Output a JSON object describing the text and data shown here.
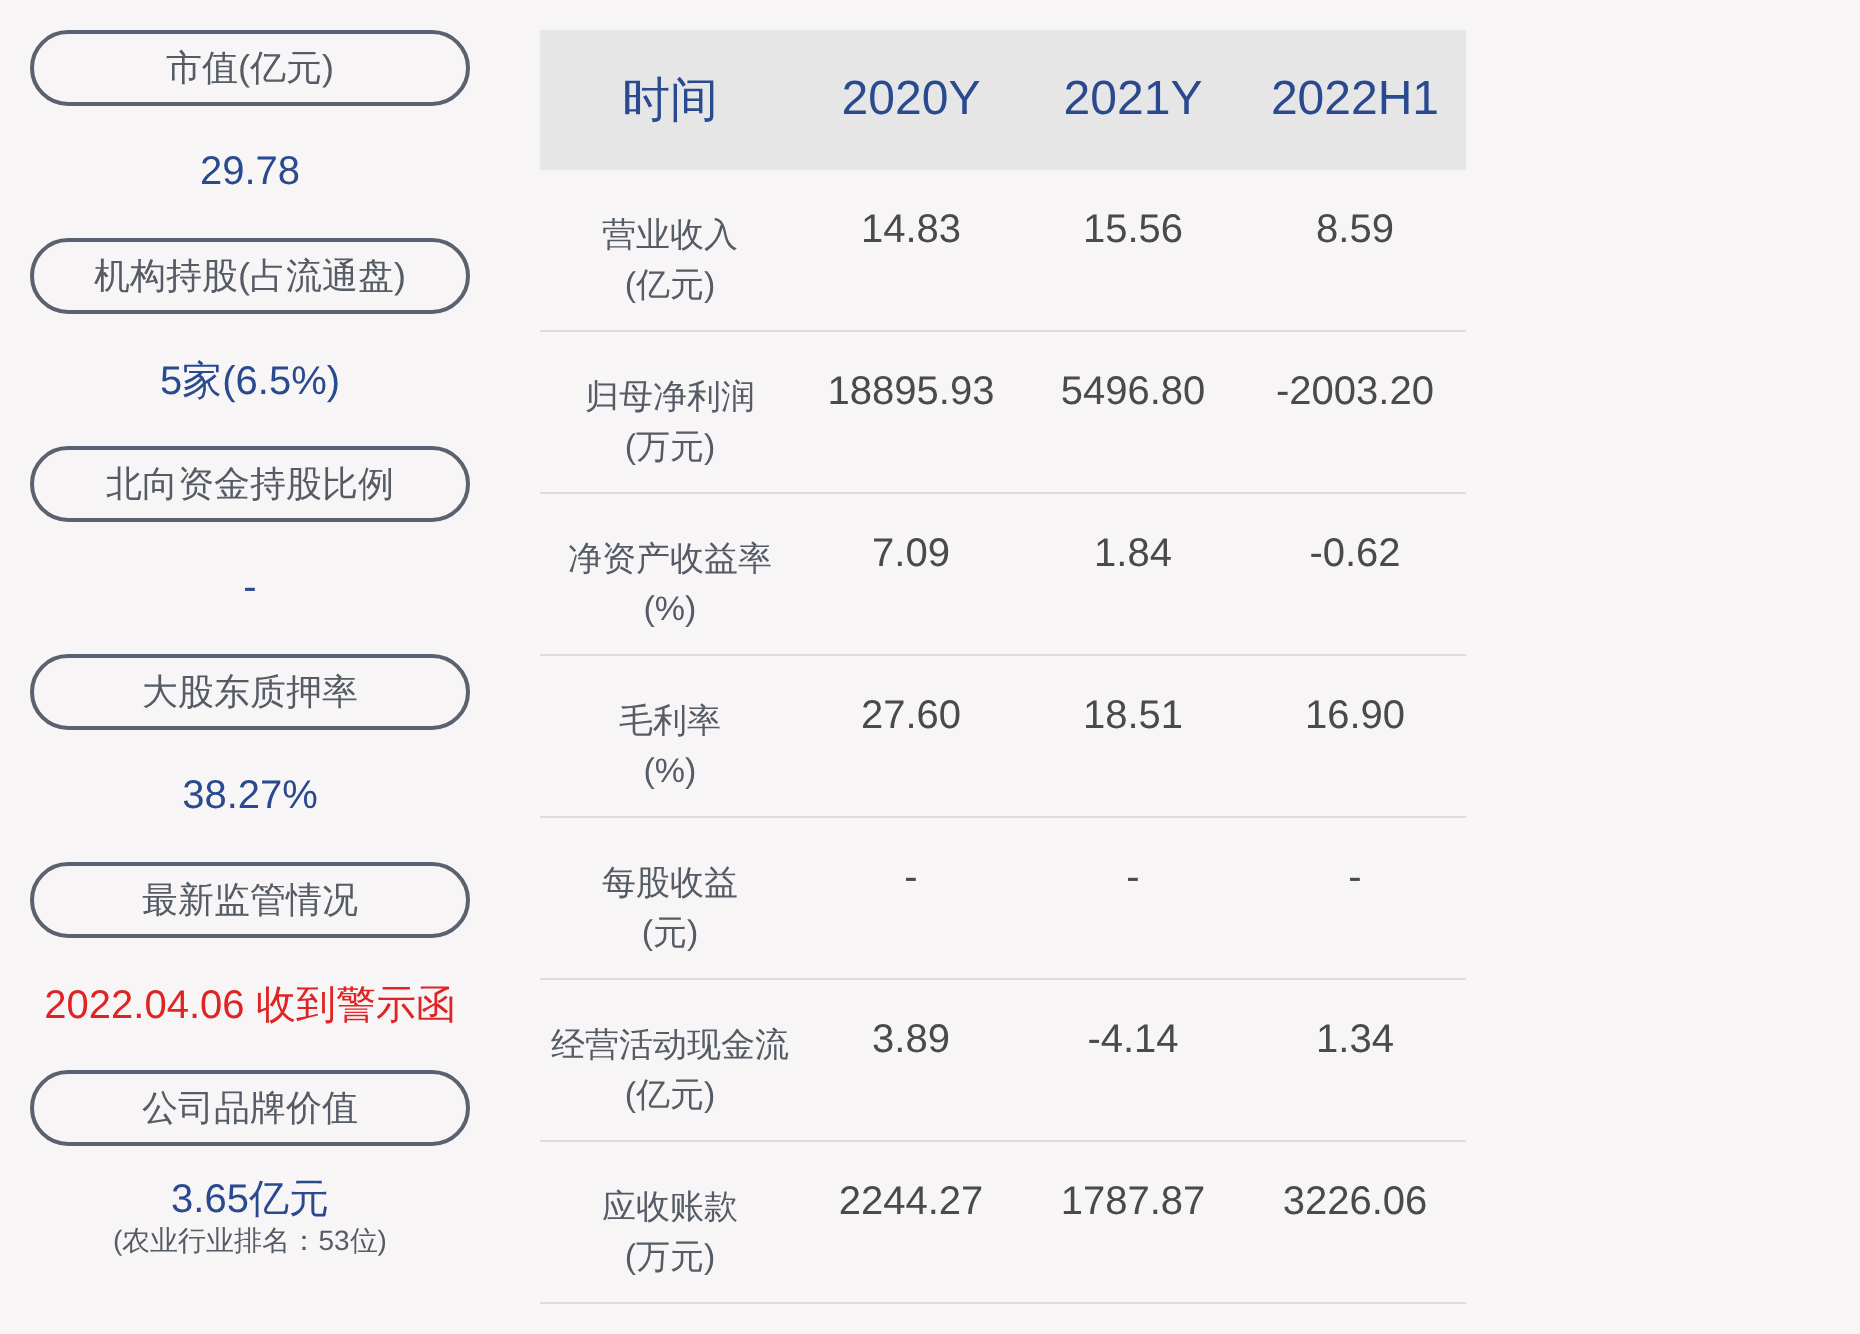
{
  "metrics": [
    {
      "label": "市值(亿元)",
      "value": "29.78",
      "color": "#2a4a8f"
    },
    {
      "label": "机构持股(占流通盘)",
      "value": "5家(6.5%)",
      "color": "#2a4a8f"
    },
    {
      "label": "北向资金持股比例",
      "value": "-",
      "color": "#2a4a8f"
    },
    {
      "label": "大股东质押率",
      "value": "38.27%",
      "color": "#2a4a8f"
    },
    {
      "label": "最新监管情况",
      "value": "2022.04.06 收到警示函",
      "color": "#e02424"
    },
    {
      "label": "公司品牌价值",
      "value": "3.65亿元",
      "color": "#2a4a8f",
      "note": "(农业行业排名：53位)"
    }
  ],
  "table": {
    "columns": [
      "时间",
      "2020Y",
      "2021Y",
      "2022H1"
    ],
    "rows": [
      {
        "label": "营业收入",
        "unit": "(亿元)",
        "values": [
          "14.83",
          "15.56",
          "8.59"
        ]
      },
      {
        "label": "归母净利润",
        "unit": "(万元)",
        "values": [
          "18895.93",
          "5496.80",
          "-2003.20"
        ]
      },
      {
        "label": "净资产收益率",
        "unit": "(%)",
        "values": [
          "7.09",
          "1.84",
          "-0.62"
        ]
      },
      {
        "label": "毛利率",
        "unit": "(%)",
        "values": [
          "27.60",
          "18.51",
          "16.90"
        ]
      },
      {
        "label": "每股收益",
        "unit": "(元)",
        "values": [
          "-",
          "-",
          "-"
        ]
      },
      {
        "label": "经营活动现金流",
        "unit": "(亿元)",
        "values": [
          "3.89",
          "-4.14",
          "1.34"
        ]
      },
      {
        "label": "应收账款",
        "unit": "(万元)",
        "values": [
          "2244.27",
          "1787.87",
          "3226.06"
        ]
      }
    ]
  }
}
